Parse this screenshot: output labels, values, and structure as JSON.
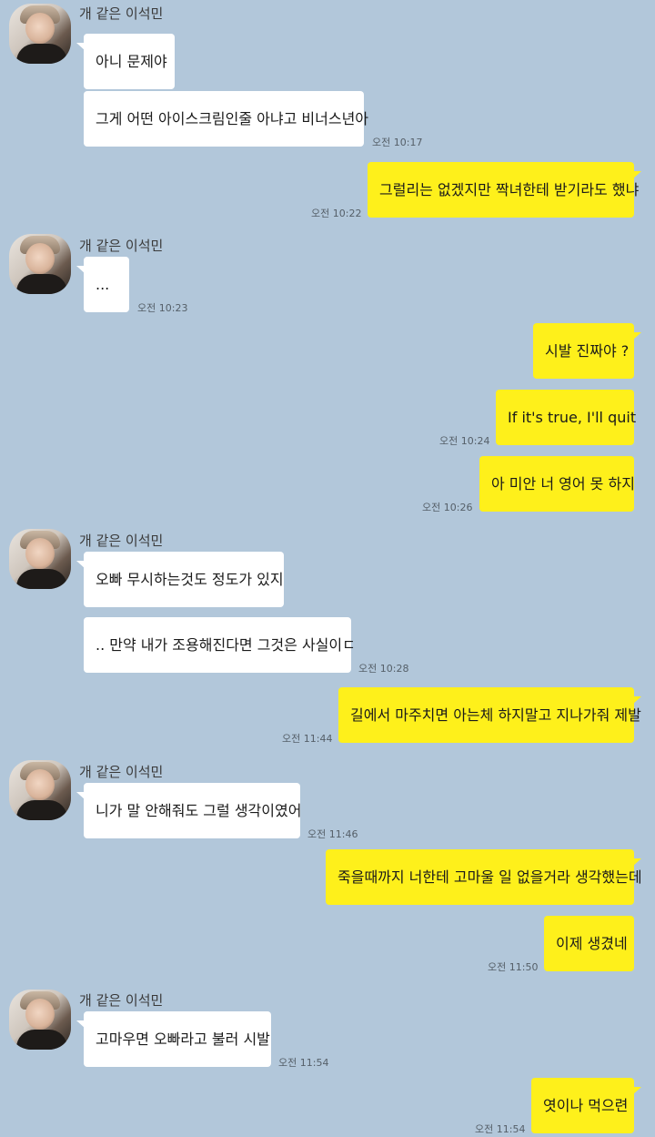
{
  "contact_name": "개 같은 이석민",
  "colors": {
    "background": "#b2c7da",
    "incoming": "#ffffff",
    "outgoing": "#fef01b"
  },
  "messages": [
    {
      "text": "아니 문제야"
    },
    {
      "text": "그게 어떤 아이스크림인줄 아냐고 비너스년아",
      "time": "오전 10:17"
    },
    {
      "text": "그럴리는 없겠지만 짝녀한테 받기라도 했냐",
      "time": "오전 10:22"
    },
    {
      "text": "...",
      "time": "오전 10:23"
    },
    {
      "text": "시발 진짜야 ?"
    },
    {
      "text": "If it's true, I'll quit",
      "time": "오전 10:24"
    },
    {
      "text": "아 미안 너 영어 못 하지",
      "time": "오전 10:26"
    },
    {
      "text": "오빠 무시하는것도 정도가 있지"
    },
    {
      "text": ".. 만약 내가 조용해진다면 그것은 사실이ㄷ",
      "time": "오전 10:28"
    },
    {
      "text": "길에서 마주치면 아는체 하지말고 지나가줘 제발",
      "time": "오전 11:44"
    },
    {
      "text": "니가 말 안해줘도 그럴 생각이였어",
      "time": "오전 11:46"
    },
    {
      "text": "죽을때까지 너한테 고마울 일 없을거라 생각했는데"
    },
    {
      "text": "이제 생겼네",
      "time": "오전 11:50"
    },
    {
      "text": "고마우면 오빠라고 불러 시발",
      "time": "오전 11:54"
    },
    {
      "text": "엿이나 먹으련",
      "time": "오전 11:54"
    }
  ]
}
